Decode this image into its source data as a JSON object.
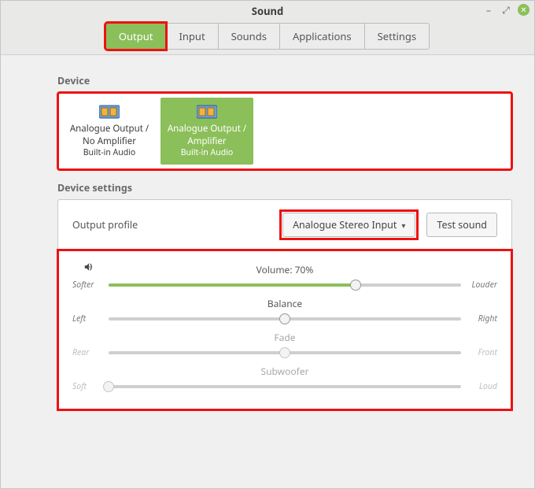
{
  "window": {
    "title": "Sound"
  },
  "tabs": {
    "output": "Output",
    "input": "Input",
    "sounds": "Sounds",
    "applications": "Applications",
    "settings": "Settings"
  },
  "sections": {
    "device": "Device",
    "device_settings": "Device settings"
  },
  "devices": [
    {
      "line1": "Analogue Output / No Amplifier",
      "line2": "Built-in Audio",
      "active": false
    },
    {
      "line1": "Analogue Output / Amplifier",
      "line2": "Built-in Audio",
      "active": true
    }
  ],
  "device_settings": {
    "output_profile_label": "Output profile",
    "output_profile_value": "Analogue Stereo Input",
    "test_sound": "Test sound"
  },
  "sliders": {
    "volume": {
      "label": "Volume: 70%",
      "percent": 70,
      "left": "Softer",
      "right": "Louder",
      "enabled": true,
      "fill": true
    },
    "balance": {
      "label": "Balance",
      "percent": 50,
      "left": "Left",
      "right": "Right",
      "enabled": true,
      "fill": false
    },
    "fade": {
      "label": "Fade",
      "percent": 50,
      "left": "Rear",
      "right": "Front",
      "enabled": false,
      "fill": false
    },
    "subwoofer": {
      "label": "Subwoofer",
      "percent": 0,
      "left": "Soft",
      "right": "Loud",
      "enabled": false,
      "fill": false
    }
  },
  "colors": {
    "accent": "#8bbf5a",
    "highlight": "#e11"
  }
}
